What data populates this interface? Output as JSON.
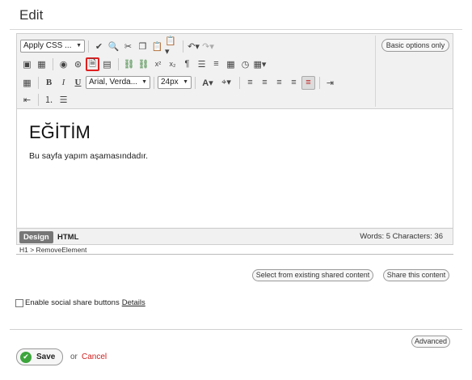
{
  "page": {
    "title": "Edit"
  },
  "toolbar": {
    "styles_combo": "Apply CSS ...",
    "font_combo": "Arial, Verda...",
    "size_combo": "24px",
    "basic_options": "Basic options only",
    "row1_icons": [
      "spellcheck-icon",
      "find-icon",
      "cut-icon",
      "copy-icon",
      "paste-icon",
      "paste-options-icon",
      "undo-icon",
      "redo-icon"
    ],
    "row2_icons": [
      "image-icon",
      "image-gallery-icon",
      "flash-icon",
      "media-icon",
      "insert-document-icon",
      "template-icon",
      "link-icon",
      "unlink-icon",
      "superscript-icon",
      "subscript-icon",
      "paragraph-icon",
      "insert-form-icon",
      "align-text-icon",
      "table-properties-icon",
      "clock-icon",
      "table-icon"
    ],
    "row3_icons": [
      "grid-icon",
      "bold-icon",
      "italic-icon",
      "underline-icon",
      "font-color-icon",
      "highlight-icon",
      "align-left-icon",
      "align-center-icon",
      "align-right-icon",
      "justify-icon",
      "strike-icon",
      "indent-icon"
    ],
    "row4_icons": [
      "outdent-icon",
      "ordered-list-icon",
      "unordered-list-icon"
    ],
    "highlight_color": "#e02020"
  },
  "content": {
    "heading": "EĞİTİM",
    "paragraph": "Bu sayfa yapım aşamasındadır."
  },
  "statusbar": {
    "design_tab": "Design",
    "html_tab": "HTML",
    "counts": "Words: 5   Characters: 36"
  },
  "path": "H1 > RemoveElement",
  "shared": {
    "select_existing": "Select from existing shared content",
    "share_this": "Share this content"
  },
  "social": {
    "label": "Enable social share buttons",
    "details": "Details"
  },
  "advanced": "Advanced",
  "actions": {
    "save": "Save",
    "or": "or",
    "cancel": "Cancel"
  }
}
